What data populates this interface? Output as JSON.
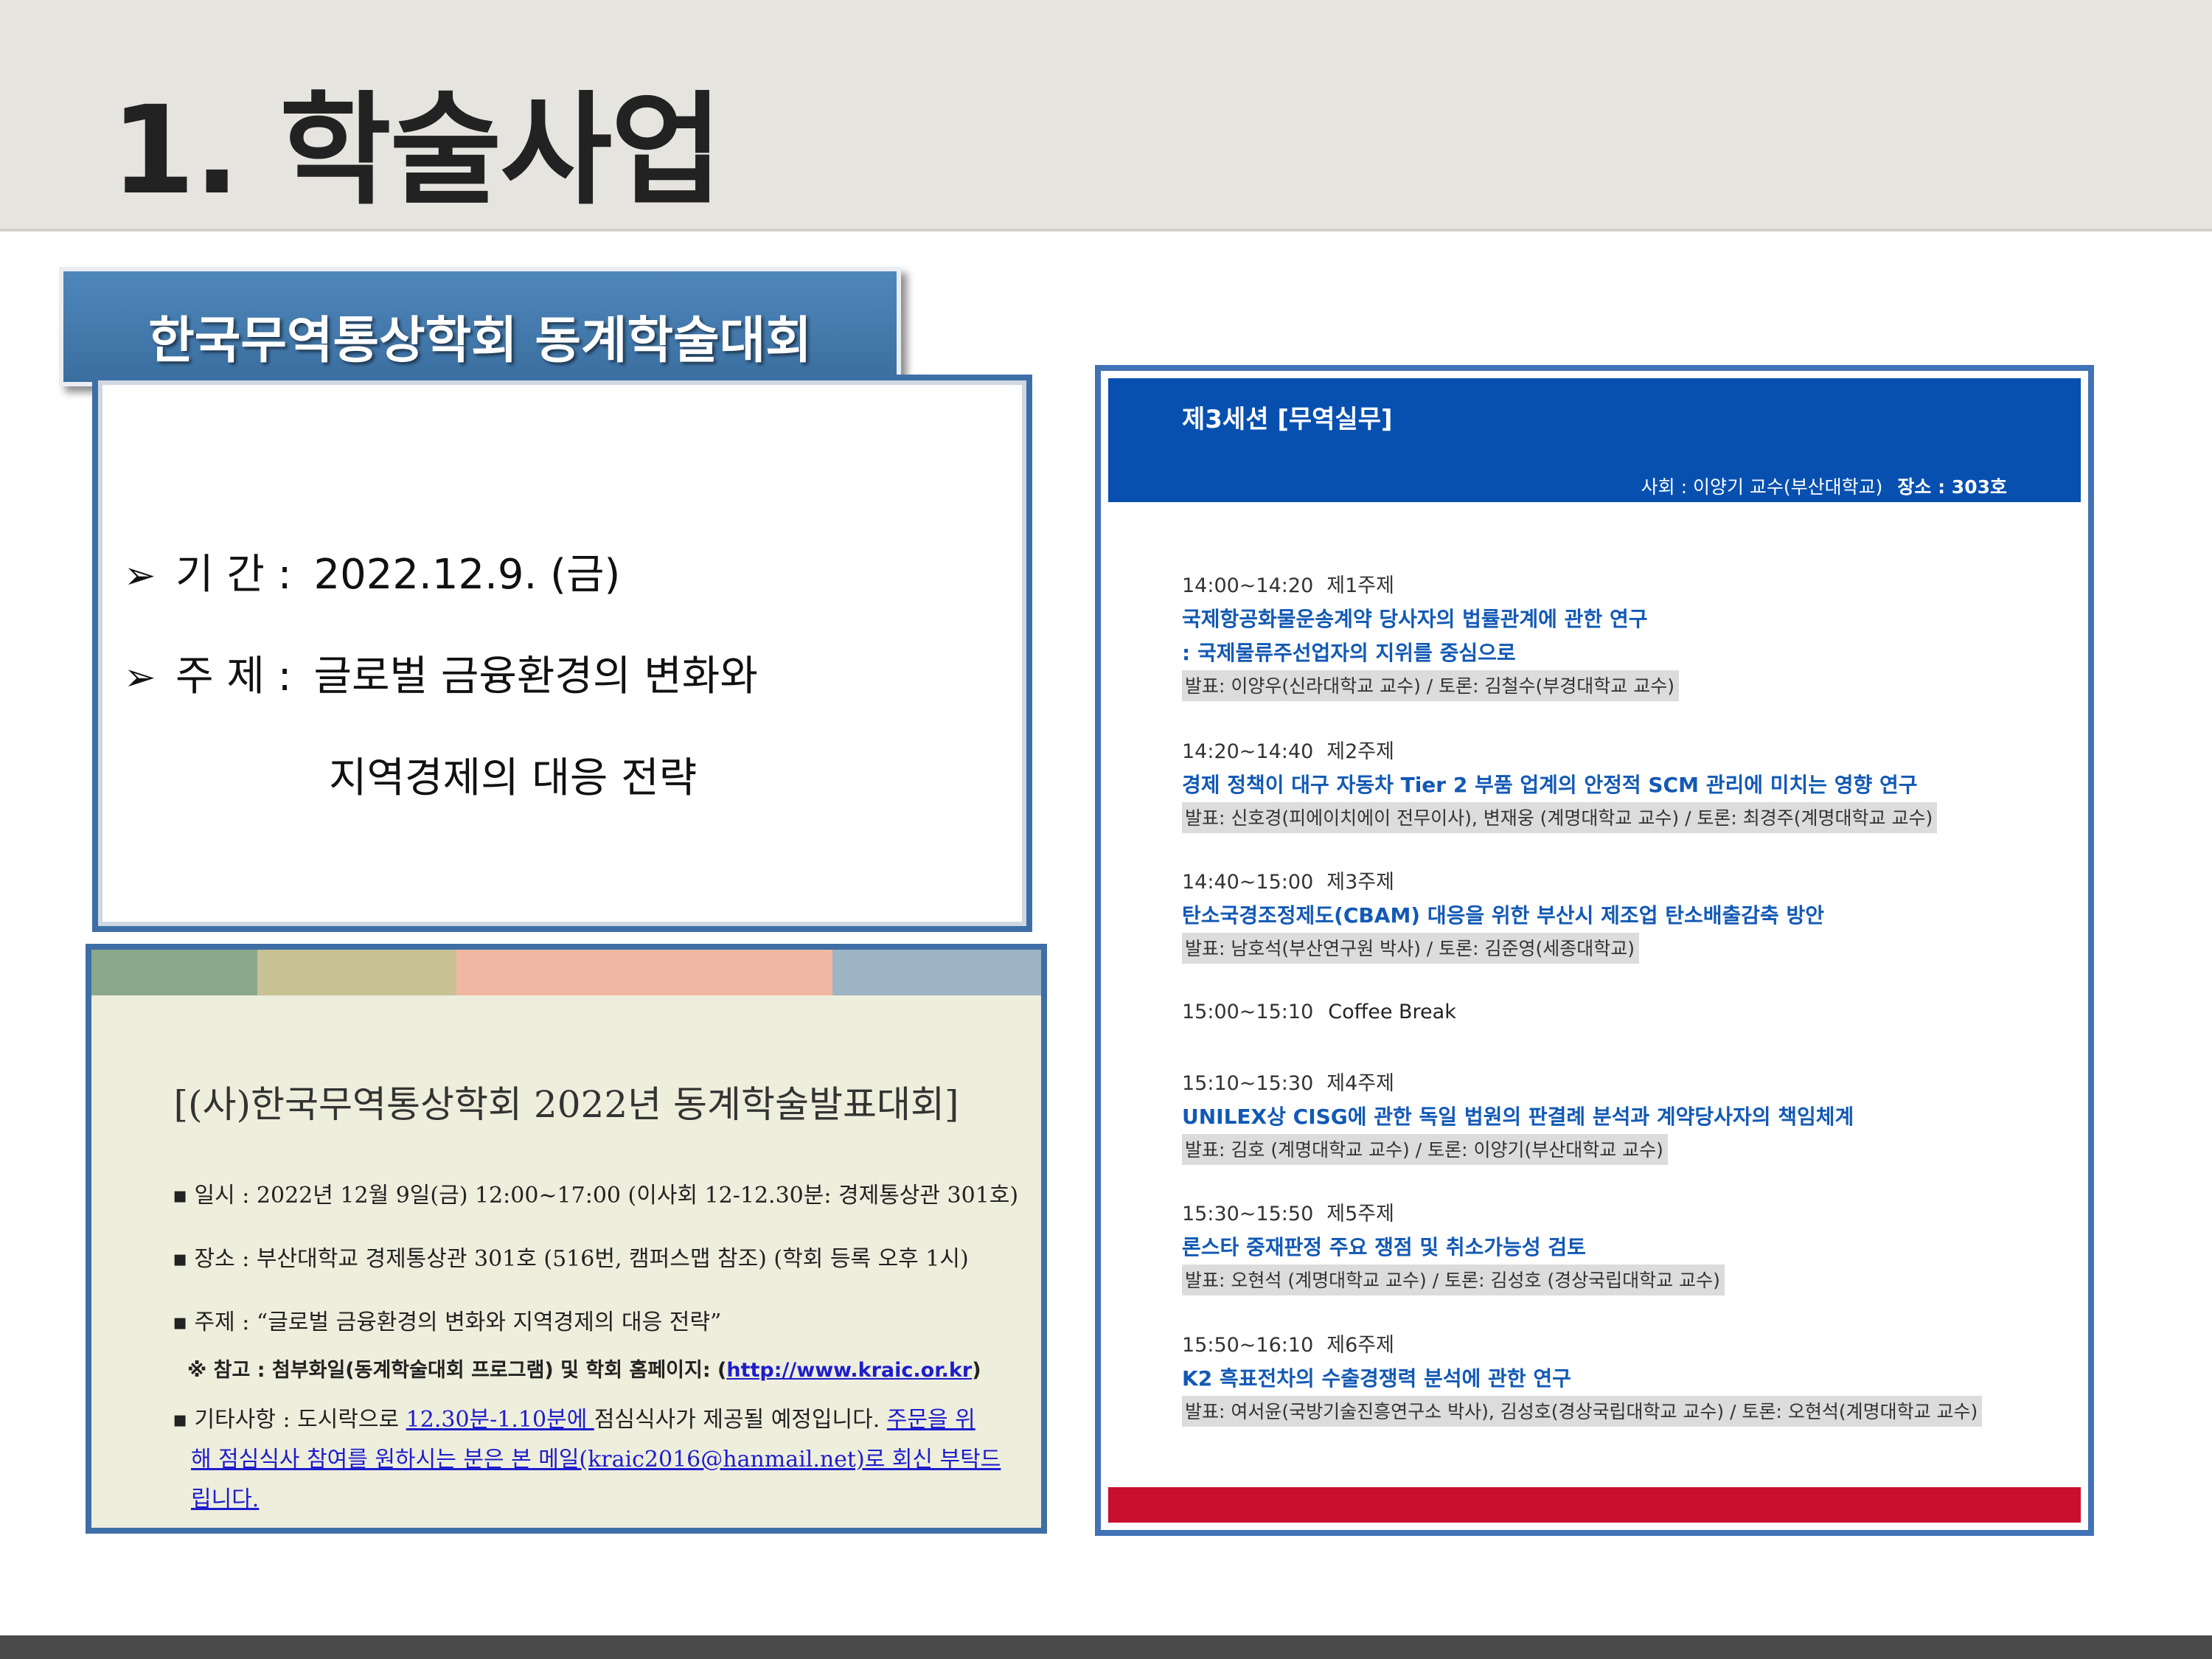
{
  "slide": {
    "title": "1. 학술사업"
  },
  "banner": {
    "text": "한국무역통상학회 동계학술대회"
  },
  "info": {
    "period_label": "기 간 :",
    "period_value": "2022.12.9. (금)",
    "topic_label": "주 제 :",
    "topic_line1": "글로벌 금융환경의 변화와",
    "topic_line2": "지역경제의 대응 전략"
  },
  "notice": {
    "title": "[(사)한국무역통상학회 2022년 동계학술발표대회]",
    "items": [
      "일시 : 2022년 12월 9일(금) 12:00~17:00  (이사회 12-12.30분: 경제통상관 301호)",
      "장소 : 부산대학교 경제통상관 301호 (516번, 캠퍼스맵 참조) (학회 등록 오후 1시)",
      "주제 : “글로벌 금융환경의 변화와 지역경제의 대응 전략”"
    ],
    "ref_note": "※ 참고 : 첨부화일(동계학술대회 프로그램) 및 학회 홈페이지: (",
    "ref_link": "http://www.kraic.or.kr",
    "ref_close": ")",
    "misc_prefix": "기타사항 : 도시락으로 ",
    "misc_time": "12.30분-1.10분에 ",
    "misc_mid": "점심식사가 제공될 예정입니다. ",
    "misc_link1": "주문을 위",
    "misc_link2": "해 점심식사 참여를 원하시는 분은 본 메일(kraic2016@hanmail.net)로 회신 부탁드",
    "misc_link3": "립니다.",
    "stripe_colors": [
      "#8ba78c",
      "#c8c193",
      "#f0b8a2",
      "#9cb4c4"
    ]
  },
  "program": {
    "session": "제3세션 [무역실무]",
    "chair": "사회 : 이양기 교수(부산대학교)",
    "room": "장소 : 303호",
    "slots": [
      {
        "time": "14:00~14:20",
        "topic_no": "제1주제",
        "titles": [
          "국제항공화물운송계약 당사자의 법률관계에 관한 연구",
          ": 국제물류주선업자의 지위를 중심으로"
        ],
        "presenters": "발표: 이양우(신라대학교 교수) / 토론: 김철수(부경대학교 교수)"
      },
      {
        "time": "14:20~14:40",
        "topic_no": "제2주제",
        "titles": [
          "경제 정책이 대구 자동차 Tier 2 부품 업계의 안정적 SCM 관리에 미치는 영향 연구"
        ],
        "presenters": "발표: 신호경(피에이치에이 전무이사), 변재웅 (계명대학교 교수) / 토론: 최경주(계명대학교 교수)"
      },
      {
        "time": "14:40~15:00",
        "topic_no": "제3주제",
        "titles": [
          "탄소국경조정제도(CBAM) 대응을 위한 부산시 제조업 탄소배출감축 방안"
        ],
        "presenters": "발표: 남호석(부산연구원 박사) / 토론: 김준영(세종대학교)"
      },
      {
        "time": "15:10~15:30",
        "topic_no": "제4주제",
        "titles": [
          "UNILEX상 CISG에 관한 독일 법원의 판결례 분석과 계약당사자의 책임체계"
        ],
        "presenters": "발표: 김호 (계명대학교 교수) / 토론: 이양기(부산대학교 교수)"
      },
      {
        "time": "15:30~15:50",
        "topic_no": "제5주제",
        "titles": [
          "론스타 중재판정 주요 쟁점 및 취소가능성 검토"
        ],
        "presenters": "발표: 오현석 (계명대학교 교수) / 토론: 김성호 (경상국립대학교 교수)"
      },
      {
        "time": "15:50~16:10",
        "topic_no": "제6주제",
        "titles": [
          "K2 흑표전차의 수출경쟁력 분석에 관한 연구"
        ],
        "presenters": "발표: 여서윤(국방기술진흥연구소 박사), 김성호(경상국립대학교 교수) / 토론: 오현석(계명대학교 교수)"
      }
    ],
    "coffee_time": "15:00~15:10",
    "coffee_label": "Coffee Break",
    "header_color": "#0750b0",
    "footer_color": "#c8102e"
  }
}
